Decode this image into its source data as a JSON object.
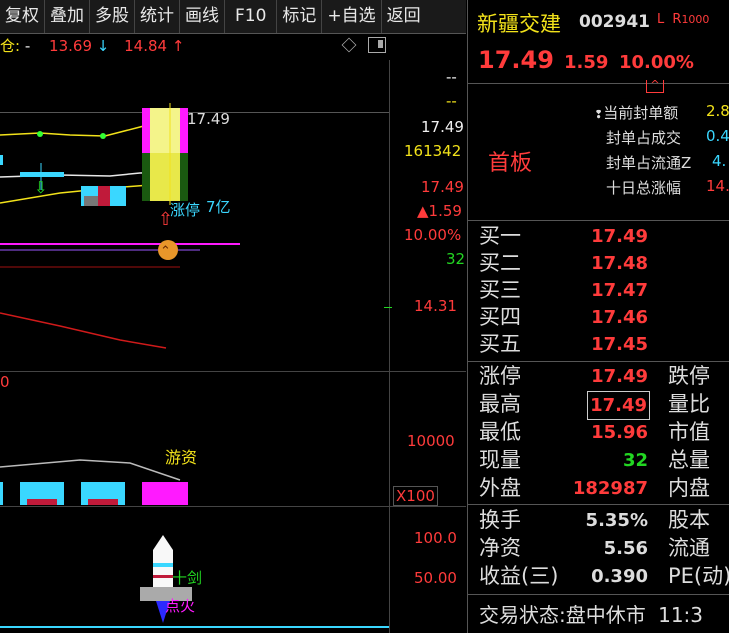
{
  "toolbar": {
    "items": [
      "复权",
      "叠加",
      "多股",
      "统计",
      "画线",
      "F10",
      "标记",
      "+自选",
      "返回"
    ]
  },
  "chart_header": {
    "prefix": "仓:",
    "dash": "-",
    "v1": "13.69",
    "v2": "14.84"
  },
  "price_axis": {
    "dash1": "--",
    "dash2": "--",
    "last": "17.49",
    "volume": "161342",
    "price_red": "17.49",
    "change": "▲1.59",
    "pct": "10.00%",
    "small": "32",
    "ma_label": "14.31",
    "vol_tick": "10000",
    "x100": "X100",
    "ind_100": "100.0",
    "ind_50": "50.00"
  },
  "chart_annotations": {
    "high_label": "17.49",
    "limit_text": "涨停",
    "amount": "7亿",
    "hot_money": "游资",
    "sword": "十剑",
    "ignite": "点火",
    "left_zero": "0"
  },
  "quote": {
    "name": "新疆交建",
    "code": "002941",
    "tag_l": "L",
    "tag_r": "R",
    "tag_num": "1000",
    "price": "17.49",
    "change": "1.59",
    "pct": "10.00%",
    "board": "首板",
    "seal_labels": [
      "当前封单额",
      "封单占成交",
      "封单占流通Z",
      "十日总涨幅"
    ],
    "seal_values": [
      "2.8",
      "0.4",
      "4.",
      "14."
    ],
    "bids": [
      {
        "k": "买一",
        "v": "17.49"
      },
      {
        "k": "买二",
        "v": "17.48"
      },
      {
        "k": "买三",
        "v": "17.47"
      },
      {
        "k": "买四",
        "v": "17.46"
      },
      {
        "k": "买五",
        "v": "17.45"
      }
    ],
    "stats": [
      {
        "k": "涨停",
        "v": "17.49",
        "k2": "跌停"
      },
      {
        "k": "最高",
        "v": "17.49",
        "k2": "量比"
      },
      {
        "k": "最低",
        "v": "15.96",
        "k2": "市值"
      },
      {
        "k": "现量",
        "v": "32",
        "k2": "总量"
      },
      {
        "k": "外盘",
        "v": "182987",
        "k2": "内盘"
      }
    ],
    "stats2": [
      {
        "k": "换手",
        "v": "5.35%",
        "k2": "股本"
      },
      {
        "k": "净资",
        "v": "5.56",
        "k2": "流通"
      },
      {
        "k": "收益(三)",
        "v": "0.390",
        "k2": "PE(动)"
      }
    ],
    "status_label": "交易状态:",
    "status_value": "盘中休市",
    "time": "11:3"
  },
  "colors": {
    "up": "#ff3b3b",
    "down": "#22d622",
    "ma_yellow": "#f2e21a",
    "magenta": "#ff1aff",
    "cyan": "#3ad7ff"
  }
}
